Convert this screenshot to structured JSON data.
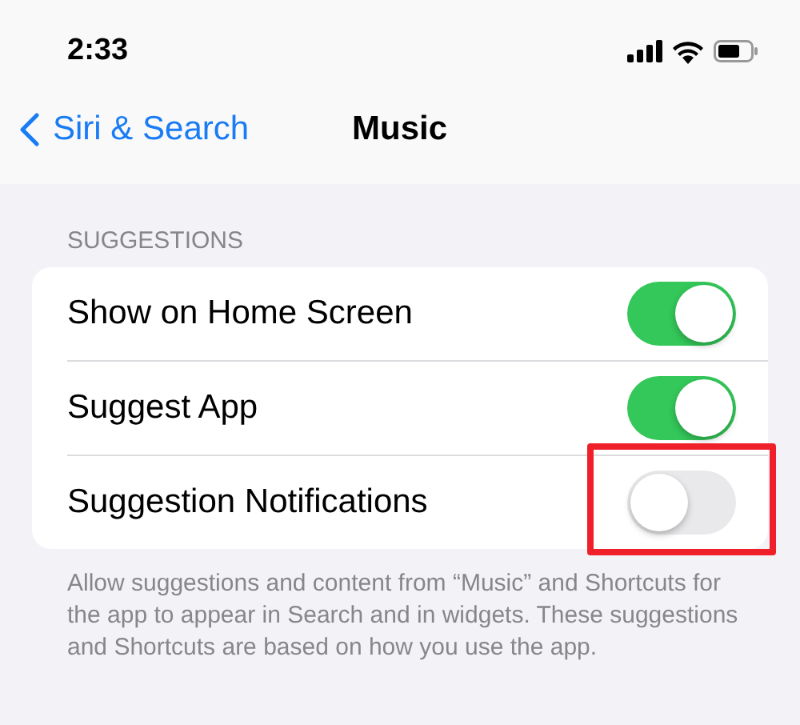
{
  "status_bar": {
    "time": "2:33"
  },
  "nav": {
    "back": "Siri & Search",
    "title": "Music"
  },
  "section": {
    "header": "SUGGESTIONS",
    "rows": [
      {
        "label": "Show on Home Screen",
        "on": true,
        "highlighted": false
      },
      {
        "label": "Suggest App",
        "on": true,
        "highlighted": false
      },
      {
        "label": "Suggestion Notifications",
        "on": false,
        "highlighted": true
      }
    ],
    "footer": "Allow suggestions and content from “Music” and Shortcuts for the app to appear in Search and in widgets. These suggestions and Shortcuts are based on how you use the app."
  }
}
